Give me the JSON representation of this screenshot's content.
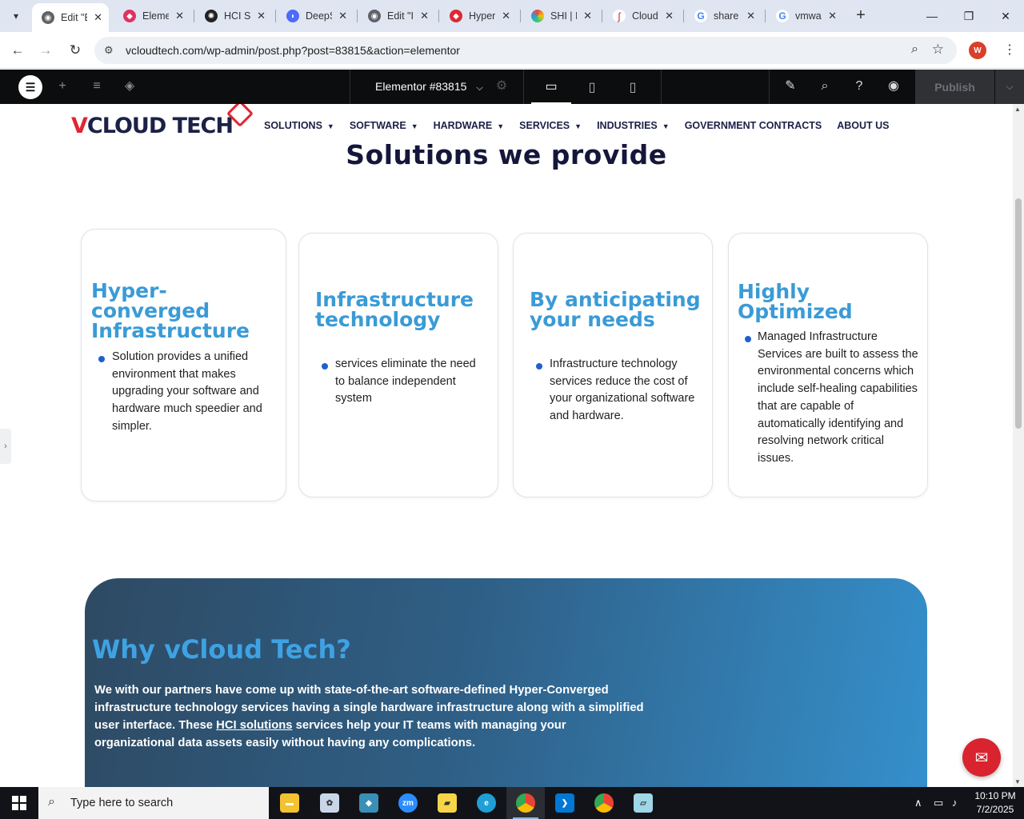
{
  "browser": {
    "tabs": [
      {
        "title": "Edit \"E",
        "active": true
      },
      {
        "title": "Eleme",
        "active": false
      },
      {
        "title": "HCI S",
        "active": false
      },
      {
        "title": "DeepS",
        "active": false
      },
      {
        "title": "Edit \"I",
        "active": false
      },
      {
        "title": "Hyper",
        "active": false
      },
      {
        "title": "SHI | I",
        "active": false
      },
      {
        "title": "Cloud",
        "active": false
      },
      {
        "title": "share",
        "active": false
      },
      {
        "title": "vmwa",
        "active": false
      }
    ],
    "url": "vcloudtech.com/wp-admin/post.php?post=83815&action=elementor",
    "profile_initial": "W"
  },
  "elementor": {
    "document_title": "Elementor #83815",
    "publish_label": "Publish"
  },
  "site": {
    "logo_text_a": "V",
    "logo_text_b": "CLOUD TECH",
    "nav": [
      {
        "label": "SOLUTIONS",
        "has_caret": true
      },
      {
        "label": "SOFTWARE",
        "has_caret": true
      },
      {
        "label": "HARDWARE",
        "has_caret": true
      },
      {
        "label": "SERVICES",
        "has_caret": true
      },
      {
        "label": "INDUSTRIES",
        "has_caret": true
      },
      {
        "label": "GOVERNMENT CONTRACTS",
        "has_caret": false
      },
      {
        "label": "ABOUT US",
        "has_caret": false
      }
    ],
    "section_title": "Solutions we provide",
    "cards": [
      {
        "title": "Hyper-converged Infrastructure",
        "text": "Solution provides a unified environment that makes upgrading your software and hardware much speedier and simpler."
      },
      {
        "title": "Infrastructure technology",
        "text": "services eliminate the need to balance independent system"
      },
      {
        "title": "By anticipating your needs",
        "text": "Infrastructure technology services reduce the cost of your organizational software and hardware."
      },
      {
        "title": "Highly Optimized",
        "text": "Managed Infrastructure Services are built to assess the environmental concerns which include self-healing capabilities that are capable of automatically identifying and resolving network critical issues."
      }
    ],
    "why": {
      "title": "Why vCloud Tech?",
      "text_before": "We with our partners have come up with state-of-the-art software-defined Hyper-Converged infrastructure technology services having a single hardware infrastructure along with a simplified user interface. These ",
      "link": "HCI solutions",
      "text_after": " services help your IT teams with managing your organizational data assets easily without having any complications."
    }
  },
  "taskbar": {
    "search_placeholder": "Type here to search",
    "time": "10:10 PM",
    "date": "7/2/2025"
  },
  "colors": {
    "accent_blue": "#3a9bd6",
    "brand_red": "#e02533",
    "navy": "#1b2147"
  }
}
